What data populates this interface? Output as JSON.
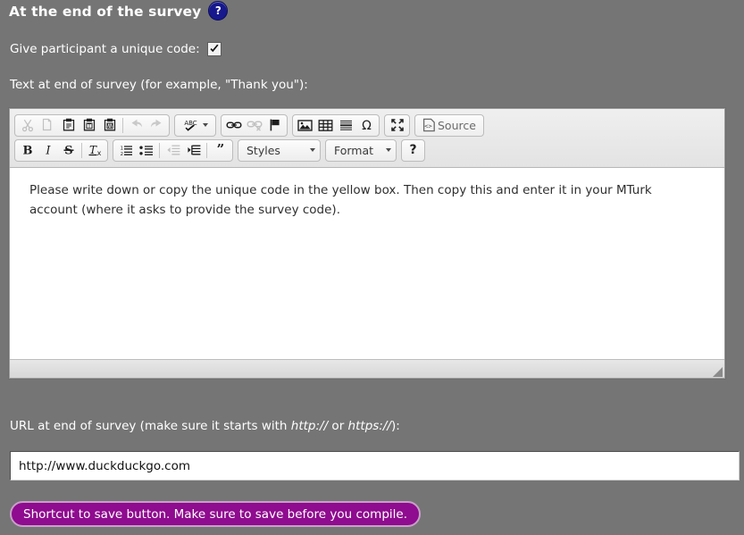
{
  "header": {
    "title": "At the end of the survey",
    "help_badge": "?",
    "help_badge_color": "#16188c"
  },
  "unique_code": {
    "label": "Give participant a unique code:",
    "checked": true
  },
  "editor_section": {
    "label": "Text at end of survey (for example, \"Thank you\"):",
    "content_paragraph": "Please write down or copy the unique code in the yellow box. Then copy this and enter it in your MTurk account (where it asks to provide the survey code).",
    "toolbar": {
      "row1": [
        {
          "name": "cut-icon",
          "label": "Cut",
          "disabled": true
        },
        {
          "name": "copy-icon",
          "label": "Copy",
          "disabled": true
        },
        {
          "name": "paste-icon",
          "label": "Paste",
          "disabled": false
        },
        {
          "name": "paste-text-icon",
          "label": "Paste as plain text",
          "disabled": false
        },
        {
          "name": "paste-word-icon",
          "label": "Paste from Word",
          "disabled": false
        },
        {
          "name": "undo-icon",
          "label": "Undo",
          "disabled": true
        },
        {
          "name": "redo-icon",
          "label": "Redo",
          "disabled": true
        },
        {
          "name": "spellcheck-icon",
          "label": "ABC",
          "disabled": false
        },
        {
          "name": "link-icon",
          "label": "Link",
          "disabled": false
        },
        {
          "name": "unlink-icon",
          "label": "Unlink",
          "disabled": true
        },
        {
          "name": "anchor-flag-icon",
          "label": "Anchor",
          "disabled": false
        },
        {
          "name": "image-icon",
          "label": "Image",
          "disabled": false
        },
        {
          "name": "table-icon",
          "label": "Table",
          "disabled": false
        },
        {
          "name": "horizontal-rule-icon",
          "label": "Horizontal line",
          "disabled": false
        },
        {
          "name": "special-char-icon",
          "label": "Ω",
          "disabled": false
        },
        {
          "name": "maximize-icon",
          "label": "Maximize",
          "disabled": false
        }
      ],
      "source_label": "Source",
      "row2": [
        {
          "name": "bold-icon",
          "label": "B",
          "disabled": false
        },
        {
          "name": "italic-icon",
          "label": "I",
          "disabled": false
        },
        {
          "name": "strikethrough-icon",
          "label": "S",
          "disabled": false
        },
        {
          "name": "remove-format-icon",
          "label": "Tx",
          "disabled": false
        },
        {
          "name": "numbered-list-icon",
          "label": "Insert/Remove Numbered List",
          "disabled": false
        },
        {
          "name": "bulleted-list-icon",
          "label": "Insert/Remove Bulleted List",
          "disabled": false
        },
        {
          "name": "decrease-indent-icon",
          "label": "Decrease Indent",
          "disabled": true
        },
        {
          "name": "increase-indent-icon",
          "label": "Increase Indent",
          "disabled": false
        },
        {
          "name": "blockquote-icon",
          "label": "Block Quote",
          "disabled": false
        }
      ],
      "styles_label": "Styles",
      "format_label": "Format",
      "about_label": "?"
    }
  },
  "url_section": {
    "label_part1": "URL at end of survey (make sure it starts with ",
    "label_http": "http://",
    "label_or": " or ",
    "label_https": "https://",
    "label_part2": "):",
    "value": "http://www.duckduckgo.com",
    "placeholder": ""
  },
  "save_shortcut": {
    "label": "Shortcut to save button. Make sure to save before you compile.",
    "background_color": "#8f0b8f",
    "border_color": "#c7a0c7"
  },
  "page": {
    "background_color": "#757575"
  }
}
